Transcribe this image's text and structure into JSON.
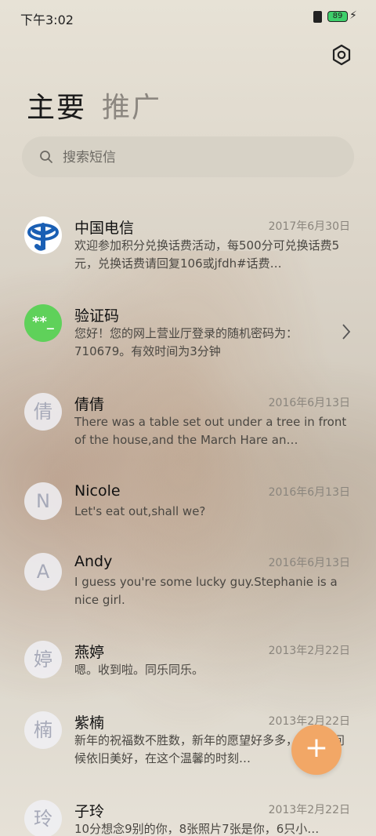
{
  "status_bar": {
    "time": "下午3:02",
    "battery_level": "89"
  },
  "tabs": [
    {
      "label": "主要",
      "active": true
    },
    {
      "label": "推广",
      "active": false
    }
  ],
  "search": {
    "placeholder": "搜索短信"
  },
  "conversations": [
    {
      "name": "中国电信",
      "date": "2017年6月30日",
      "preview": "欢迎参加积分兑换话费活动，每500分可兑换话费5元，兑换话费请回复106或jfdh#话费…",
      "avatar": ""
    },
    {
      "name": "验证码",
      "date": "",
      "preview": "您好！您的网上营业厅登录的随机密码为：710679。有效时间为3分钟",
      "avatar": "**_"
    },
    {
      "name": "倩倩",
      "date": "2016年6月13日",
      "preview": "There was a table set out under a tree in front of the house,and the March Hare an…",
      "avatar": "倩"
    },
    {
      "name": "Nicole",
      "date": "2016年6月13日",
      "preview": "Let's eat out,shall we?",
      "avatar": "N"
    },
    {
      "name": "Andy",
      "date": "2016年6月13日",
      "preview": "I guess you're some lucky guy.Stephanie is a nice girl.",
      "avatar": "A"
    },
    {
      "name": "燕婷",
      "date": "2013年2月22日",
      "preview": "嗯。收到啦。同乐同乐。",
      "avatar": "婷"
    },
    {
      "name": "紫楠",
      "date": "2013年2月22日",
      "preview": "新年的祝福数不胜数，新年的愿望好多多，新年的问候依旧美好，在这个温馨的时刻…",
      "avatar": "楠"
    },
    {
      "name": "子玲",
      "date": "2013年2月22日",
      "preview": "10分想念9别的你，8张照片7张是你，6只小…",
      "avatar": "玲"
    }
  ],
  "icons": {
    "settings": "settings-icon",
    "search": "search-icon",
    "fab": "plus-icon"
  },
  "colors": {
    "fab": "#f2a766",
    "code_avatar": "#5fd15a",
    "telecom_blue": "#1a5fb4"
  },
  "fab_label": "+"
}
